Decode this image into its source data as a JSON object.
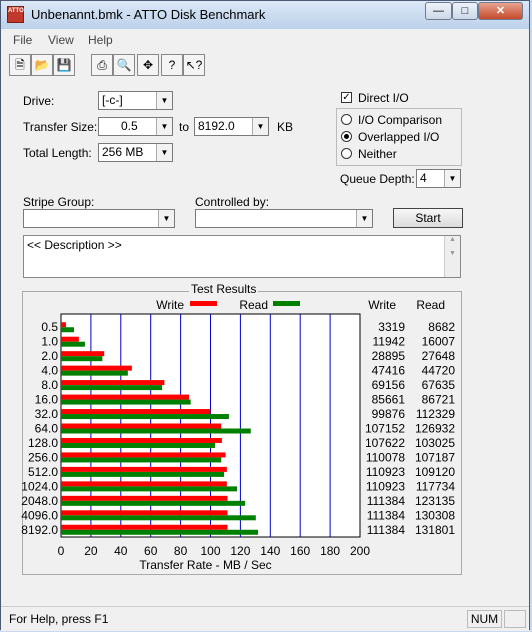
{
  "window": {
    "title": "Unbenannt.bmk - ATTO Disk Benchmark",
    "icon_text": "ATTO"
  },
  "menu": [
    "File",
    "View",
    "Help"
  ],
  "toolbar_icons": [
    "new-icon",
    "open-icon",
    "save-icon",
    "print-icon",
    "print-preview-icon",
    "move-icon",
    "help-icon",
    "context-help-icon"
  ],
  "form": {
    "drive_label": "Drive:",
    "drive_value": "[-c-]",
    "transfer_size_label": "Transfer Size:",
    "transfer_from": "0.5",
    "to_label": "to",
    "transfer_to": "8192.0",
    "kb_label": "KB",
    "total_length_label": "Total Length:",
    "total_length_value": "256 MB",
    "direct_io_label": "Direct I/O",
    "direct_io_checked": true,
    "io_comparison_label": "I/O Comparison",
    "overlapped_io_label": "Overlapped I/O",
    "neither_label": "Neither",
    "selected_io_mode": "Overlapped I/O",
    "queue_depth_label": "Queue Depth:",
    "queue_depth_value": "4",
    "stripe_group_label": "Stripe Group:",
    "stripe_group_value": "",
    "controlled_by_label": "Controlled by:",
    "controlled_by_value": "",
    "start_label": "Start",
    "description": "<< Description >>"
  },
  "results": {
    "title": "Test Results",
    "write_legend": "Write",
    "read_legend": "Read",
    "write_header": "Write",
    "read_header": "Read"
  },
  "chart_data": {
    "type": "bar",
    "xlabel": "Transfer Rate - MB / Sec",
    "xlim": [
      0,
      200
    ],
    "xticks": [
      "0",
      "20",
      "40",
      "60",
      "80",
      "100",
      "120",
      "140",
      "160",
      "180",
      "200"
    ],
    "categories": [
      "0.5",
      "1.0",
      "2.0",
      "4.0",
      "8.0",
      "16.0",
      "32.0",
      "64.0",
      "128.0",
      "256.0",
      "512.0",
      "1024.0",
      "2048.0",
      "4096.0",
      "8192.0"
    ],
    "series": [
      {
        "name": "Write",
        "color": "#ff0000",
        "values": [
          3319,
          11942,
          28895,
          47416,
          69156,
          85661,
          99876,
          107152,
          107622,
          110078,
          110923,
          110923,
          111384,
          111384,
          111384
        ]
      },
      {
        "name": "Read",
        "color": "#008000",
        "values": [
          8682,
          16007,
          27648,
          44720,
          67635,
          86721,
          112329,
          126932,
          103025,
          107187,
          109120,
          117734,
          123135,
          130308,
          131801
        ]
      }
    ]
  },
  "status": {
    "help_text": "For Help, press F1",
    "num_indicator": "NUM"
  }
}
